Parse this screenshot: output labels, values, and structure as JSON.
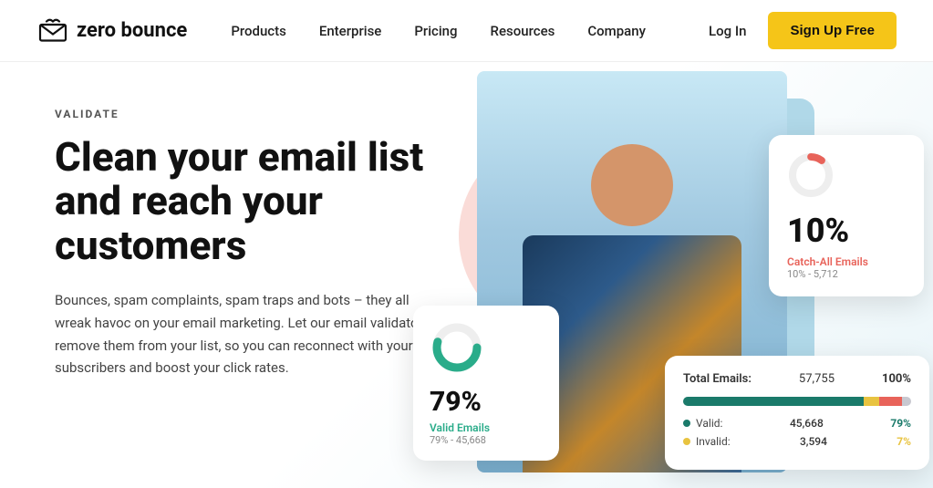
{
  "nav": {
    "logo_text": "zero bounce",
    "links": [
      {
        "label": "Products",
        "id": "products"
      },
      {
        "label": "Enterprise",
        "id": "enterprise"
      },
      {
        "label": "Pricing",
        "id": "pricing"
      },
      {
        "label": "Resources",
        "id": "resources"
      },
      {
        "label": "Company",
        "id": "company"
      }
    ],
    "login_label": "Log In",
    "signup_label": "Sign Up Free"
  },
  "hero": {
    "validate_label": "VALIDATE",
    "title_line1": "Clean your email list",
    "title_line2": "and reach your",
    "title_line3": "customers",
    "description": "Bounces, spam complaints, spam traps and bots – they all wreak havoc on your email marketing. Let our email validator remove them from your list, so you can reconnect with your subscribers and boost your click rates."
  },
  "card_top": {
    "percent": "10%",
    "label": "Catch-All Emails",
    "sublabel": "10% - 5,712"
  },
  "card_bottom_left": {
    "percent": "79%",
    "label": "Valid Emails",
    "sublabel": "79% - 45,668"
  },
  "card_stats": {
    "title": "Total Emails:",
    "total": "57,755",
    "total_pct": "100%",
    "rows": [
      {
        "dot_color": "#1a7a6a",
        "label": "Valid:",
        "count": "45,668",
        "pct": "79%",
        "pct_color": "#1a7a6a"
      },
      {
        "dot_color": "#e8c340",
        "label": "Invalid:",
        "count": "3,594",
        "pct": "7%",
        "pct_color": "#e8c340"
      }
    ],
    "bar_segments": [
      {
        "color": "#1a7a6a",
        "width": 79
      },
      {
        "color": "#e8c340",
        "width": 7
      },
      {
        "color": "#e8635a",
        "width": 10
      },
      {
        "color": "#c8c8d0",
        "width": 4
      }
    ]
  }
}
